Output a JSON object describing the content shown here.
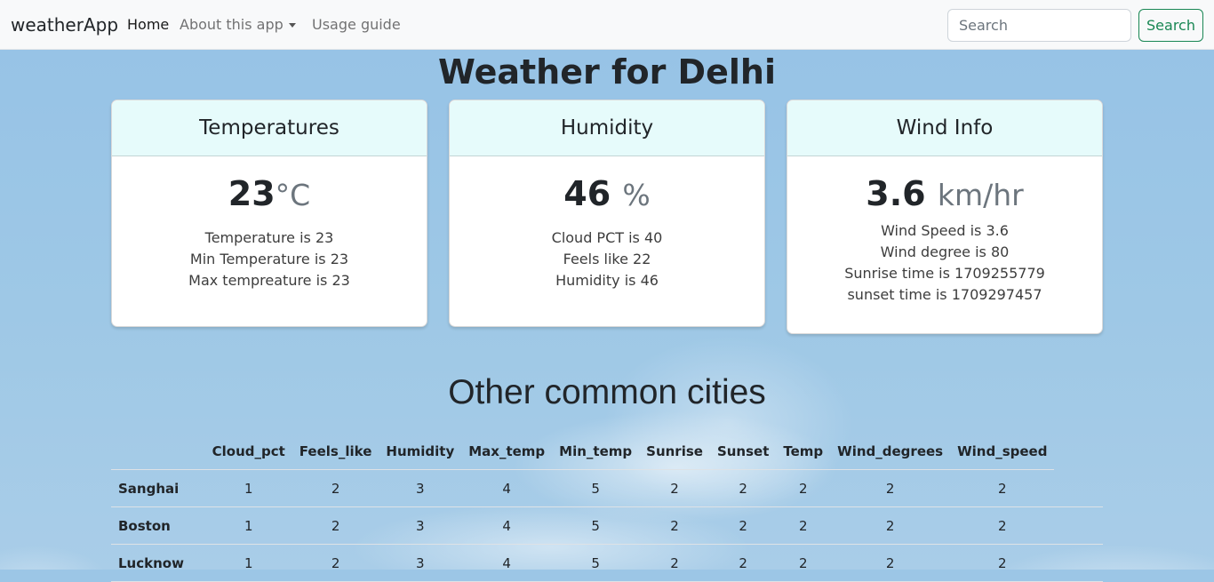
{
  "navbar": {
    "brand": "weatherApp",
    "links": [
      "Home",
      "About this app",
      "Usage guide"
    ],
    "search_placeholder": "Search",
    "search_button": "Search"
  },
  "page_title": "Weather for Delhi",
  "cards": {
    "temperatures": {
      "header": "Temperatures",
      "value": "23",
      "unit": "°C",
      "lines": [
        "Temperature is 23",
        "Min Temperature is 23",
        "Max tempreature is 23"
      ]
    },
    "humidity": {
      "header": "Humidity",
      "value": "46",
      "unit": "%",
      "lines": [
        "Cloud PCT is 40",
        "Feels like 22",
        "Humidity is 46"
      ]
    },
    "wind": {
      "header": "Wind Info",
      "value": "3.6",
      "unit": "km/hr",
      "lines": [
        "Wind Speed is 3.6",
        "Wind degree is 80",
        "Sunrise time is 1709255779",
        "sunset time is 1709297457"
      ]
    }
  },
  "other_cities": {
    "title": "Other common cities",
    "columns": [
      "Cloud_pct",
      "Feels_like",
      "Humidity",
      "Max_temp",
      "Min_temp",
      "Sunrise",
      "Sunset",
      "Temp",
      "Wind_degrees",
      "Wind_speed"
    ],
    "rows": [
      {
        "city": "Sanghai",
        "values": [
          "1",
          "2",
          "3",
          "4",
          "5",
          "2",
          "2",
          "2",
          "2",
          "2"
        ]
      },
      {
        "city": "Boston",
        "values": [
          "1",
          "2",
          "3",
          "4",
          "5",
          "2",
          "2",
          "2",
          "2",
          "2"
        ]
      },
      {
        "city": "Lucknow",
        "values": [
          "1",
          "2",
          "3",
          "4",
          "5",
          "2",
          "2",
          "2",
          "2",
          "2"
        ]
      }
    ]
  }
}
